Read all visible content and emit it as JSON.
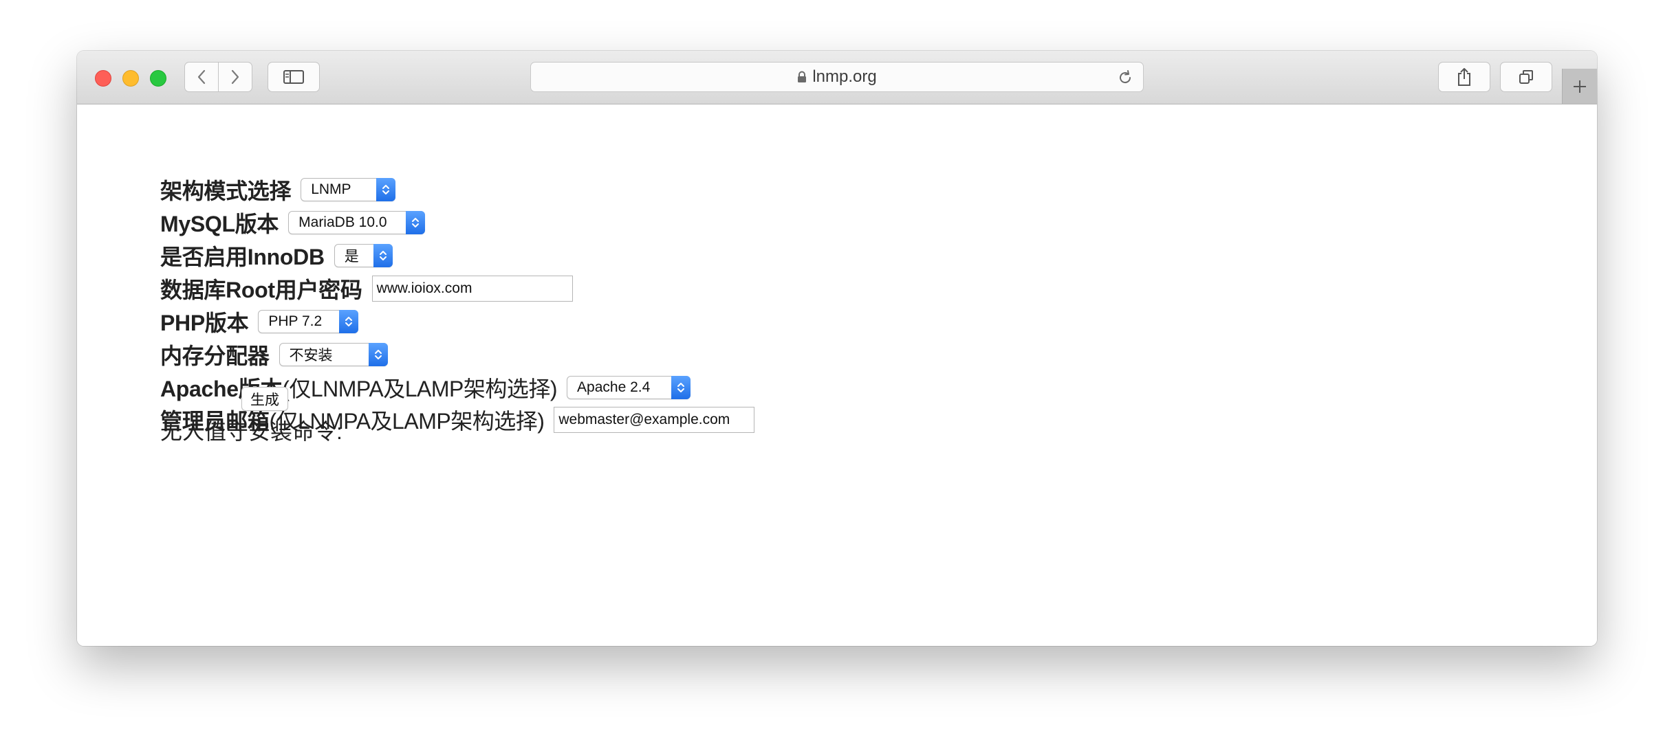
{
  "browser": {
    "url": "lnmp.org",
    "icons": [
      "back-icon",
      "forward-icon",
      "sidebar-icon",
      "lock-icon",
      "reload-icon",
      "share-icon",
      "tabs-icon",
      "plus-icon"
    ]
  },
  "form": {
    "arch": {
      "label": "架构模式选择",
      "value": "LNMP"
    },
    "mysql": {
      "label": "MySQL版本",
      "value": "MariaDB 10.0"
    },
    "innodb": {
      "label": "是否启用InnoDB",
      "value": "是"
    },
    "root_pwd": {
      "label": "数据库Root用户密码",
      "value": "www.ioiox.com"
    },
    "php": {
      "label": "PHP版本",
      "value": "PHP 7.2"
    },
    "allocator": {
      "label": "内存分配器",
      "value": "不安装"
    },
    "apache": {
      "label": "Apache版本",
      "note": "(仅LNMPA及LAMP架构选择)",
      "value": "Apache 2.4"
    },
    "email": {
      "label": "管理员邮箱",
      "note": "(仅LNMPA及LAMP架构选择)",
      "value": "webmaster@example.com"
    },
    "generate_label": "生成",
    "command_label": "无人值守安装命令:"
  },
  "colors": {
    "select_accent": "#2b7cf0"
  }
}
